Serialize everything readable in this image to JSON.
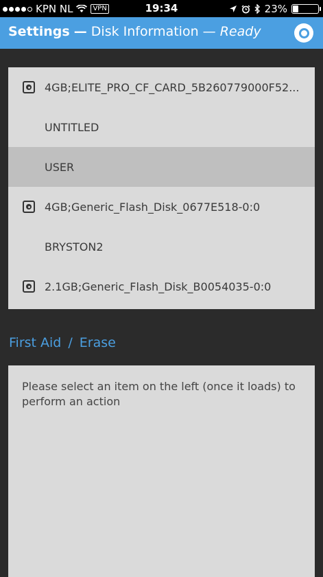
{
  "status_bar": {
    "carrier": "KPN NL",
    "vpn_label": "VPN",
    "time": "19:34",
    "battery_text": "23%",
    "battery_level": 0.23,
    "signal_bars_filled": 4,
    "signal_bars_total": 5
  },
  "header": {
    "app_name": "Settings",
    "dash1": "—",
    "section": "Disk Information",
    "dash2": "—",
    "status": "Ready",
    "accent_color": "#4b9fe1"
  },
  "disks": [
    {
      "label": "4GB;ELITE_PRO_CF_CARD_5B260779000F52...",
      "kind": "drive",
      "icon": "disk-icon",
      "selected": false
    },
    {
      "label": "UNTITLED",
      "kind": "volume",
      "selected": false
    },
    {
      "label": "USER",
      "kind": "volume",
      "selected": true
    },
    {
      "label": "4GB;Generic_Flash_Disk_0677E518-0:0",
      "kind": "drive",
      "icon": "disk-icon",
      "selected": false
    },
    {
      "label": "BRYSTON2",
      "kind": "volume",
      "selected": false
    },
    {
      "label": "2.1GB;Generic_Flash_Disk_B0054035-0:0",
      "kind": "drive",
      "icon": "disk-icon",
      "selected": false
    }
  ],
  "actions": {
    "first_aid": "First Aid",
    "separator": "/",
    "erase": "Erase"
  },
  "message": "Please select an item on the left (once it loads) to perform an action"
}
